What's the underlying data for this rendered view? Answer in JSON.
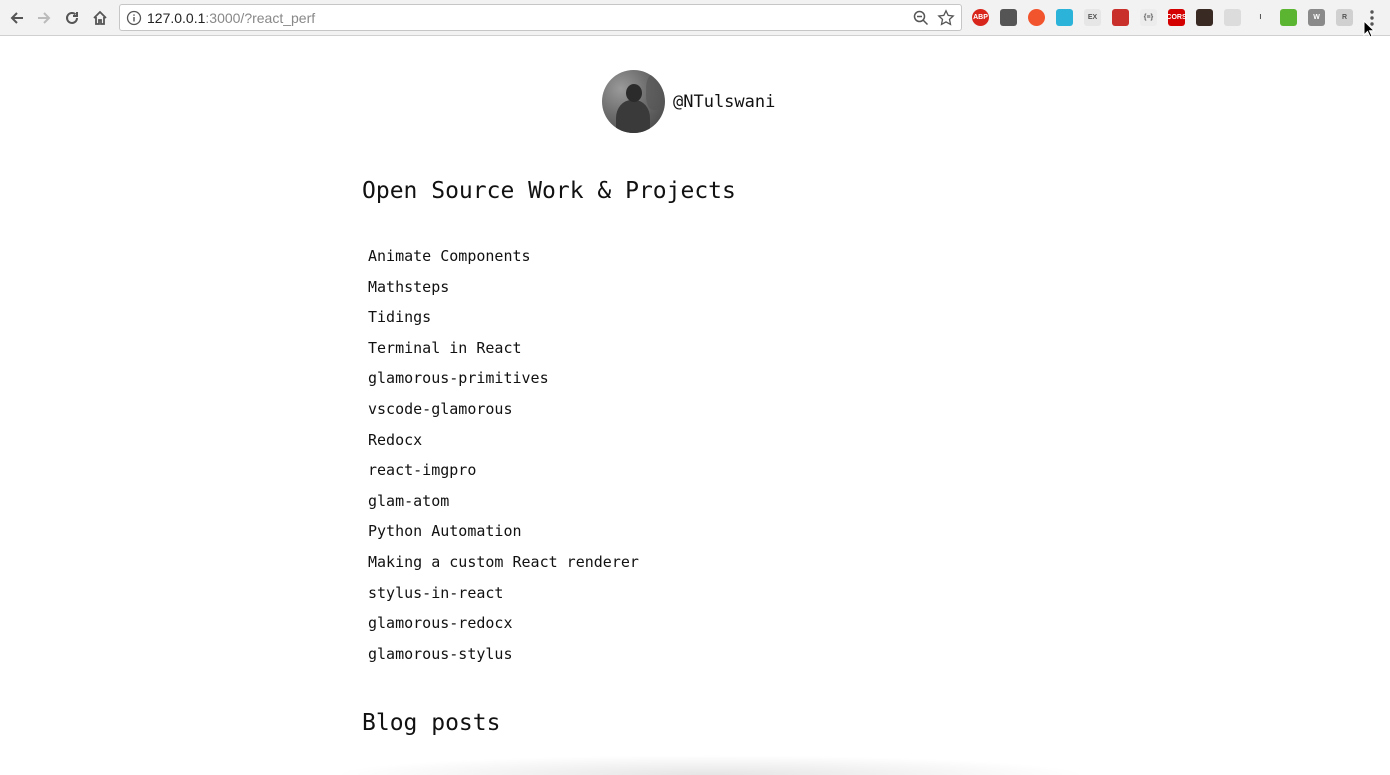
{
  "browser": {
    "url_host": "127.0.0.1",
    "url_path": ":3000/?react_perf",
    "extensions": [
      {
        "icon": "adblock-plus-icon",
        "label": "ABP",
        "color": "#d9261c"
      },
      {
        "icon": "pocket-icon",
        "label": "",
        "color": "#555555"
      },
      {
        "icon": "fire-icon",
        "label": "",
        "color": "#f2542d"
      },
      {
        "icon": "pinwheel-icon",
        "label": "",
        "color": "#2bb3d9"
      },
      {
        "icon": "ex-icon",
        "label": "EX",
        "color": "#e6e6e6"
      },
      {
        "icon": "grid-extension-icon",
        "label": "",
        "color": "#c9302c"
      },
      {
        "icon": "json-braces-icon",
        "label": "{≡}",
        "color": "#ececec"
      },
      {
        "icon": "cors-icon",
        "label": "CORS",
        "color": "#d40000"
      },
      {
        "icon": "cat-face-icon",
        "label": "",
        "color": "#3a2a24"
      },
      {
        "icon": "tree-graph-icon",
        "label": "",
        "color": "#dcdcdc"
      },
      {
        "icon": "instapaper-icon",
        "label": "I",
        "color": "#f2f2f2"
      },
      {
        "icon": "green-printer-icon",
        "label": "",
        "color": "#5cb531"
      },
      {
        "icon": "wikipedia-w-icon",
        "label": "W",
        "color": "#8a8a8a"
      },
      {
        "icon": "r-extension-icon",
        "label": "R",
        "color": "#d0d0d0"
      }
    ]
  },
  "profile": {
    "handle": "@NTulswani"
  },
  "sections": {
    "projects_title": "Open Source Work & Projects",
    "blog_title": "Blog posts"
  },
  "projects": [
    "Animate Components",
    "Mathsteps",
    "Tidings",
    "Terminal in React",
    "glamorous-primitives",
    "vscode-glamorous",
    "Redocx",
    "react-imgpro",
    "glam-atom",
    "Python Automation",
    "Making a custom React renderer",
    "stylus-in-react",
    "glamorous-redocx",
    "glamorous-stylus"
  ]
}
